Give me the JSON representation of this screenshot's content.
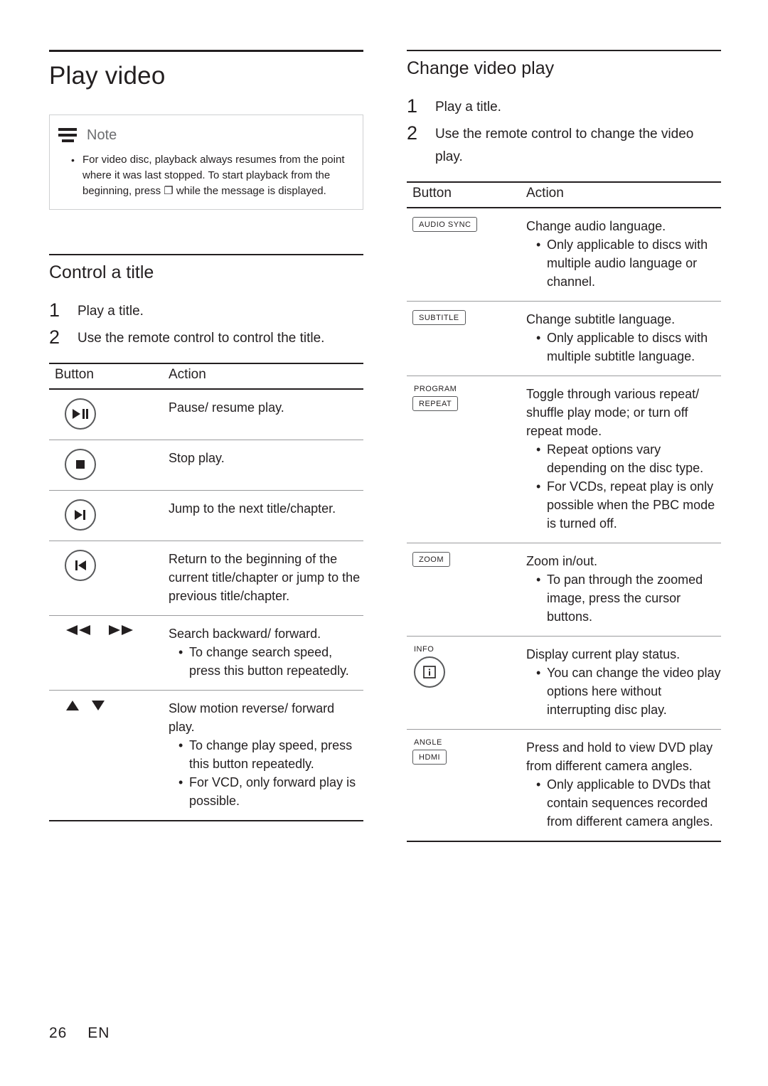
{
  "page": {
    "number": "26",
    "language_code": "EN"
  },
  "left_column": {
    "title": "Play video",
    "note": {
      "label": "Note",
      "items": [
        "For video disc, playback always resumes from the point where it was last stopped. To start playback from the beginning, press ❐ while the message is displayed."
      ]
    },
    "section": {
      "title": "Control a title",
      "steps": [
        {
          "num": "1",
          "text": "Play a title."
        },
        {
          "num": "2",
          "text": "Use the remote control to control the title."
        }
      ],
      "table": {
        "headers": [
          "Button",
          "Action"
        ],
        "rows": [
          {
            "button": {
              "type": "round",
              "icon": "play-pause-icon"
            },
            "lines": [
              "Pause/ resume play."
            ],
            "subs": []
          },
          {
            "button": {
              "type": "round",
              "icon": "stop-icon"
            },
            "lines": [
              "Stop play."
            ],
            "subs": []
          },
          {
            "button": {
              "type": "round",
              "icon": "next-track-icon"
            },
            "lines": [
              "Jump to the next title/chapter."
            ],
            "subs": []
          },
          {
            "button": {
              "type": "round",
              "icon": "previous-track-icon"
            },
            "lines": [
              "Return to the beginning of the current title/chapter or jump to the previous title/chapter."
            ],
            "subs": []
          },
          {
            "button": {
              "type": "arrows",
              "icon": "rewind-forward-icons"
            },
            "lines": [
              "Search backward/ forward."
            ],
            "subs": [
              "To change search speed, press this button repeatedly."
            ]
          },
          {
            "button": {
              "type": "triangles",
              "icon": "up-down-triangle-icons"
            },
            "lines": [
              "Slow motion reverse/ forward play."
            ],
            "subs": [
              "To change play speed, press this button repeatedly.",
              "For VCD, only forward play is possible."
            ]
          }
        ]
      }
    }
  },
  "right_column": {
    "section": {
      "title": "Change video play",
      "steps": [
        {
          "num": "1",
          "text": "Play a title."
        },
        {
          "num": "2",
          "text": "Use the remote control to change the video play."
        }
      ],
      "table": {
        "headers": [
          "Button",
          "Action"
        ],
        "rows": [
          {
            "button": {
              "type": "label",
              "text": "AUDIO SYNC"
            },
            "lines": [
              "Change audio language."
            ],
            "subs": [
              "Only applicable to discs with multiple audio language or channel."
            ]
          },
          {
            "button": {
              "type": "label",
              "text": "SUBTITLE"
            },
            "lines": [
              "Change subtitle language."
            ],
            "subs": [
              "Only applicable to discs with multiple subtitle language."
            ]
          },
          {
            "button": {
              "type": "plain-label",
              "plain": "PROGRAM",
              "text": "REPEAT"
            },
            "lines": [
              "Toggle through various repeat/ shuffle play mode; or turn off repeat mode."
            ],
            "subs": [
              "Repeat options vary depending on the disc type.",
              "For VCDs, repeat play is only possible when the PBC mode is turned off."
            ]
          },
          {
            "button": {
              "type": "label",
              "text": "ZOOM"
            },
            "lines": [
              "Zoom in/out."
            ],
            "subs": [
              "To pan through the zoomed image, press the cursor buttons."
            ]
          },
          {
            "button": {
              "type": "plain-round",
              "plain": "INFO",
              "icon": "info-icon"
            },
            "lines": [
              "Display current play status."
            ],
            "subs": [
              "You can change the video play options here without interrupting disc play."
            ]
          },
          {
            "button": {
              "type": "plain-label",
              "plain": "ANGLE",
              "text": "HDMI"
            },
            "lines": [
              "Press and hold to view DVD play from different camera angles."
            ],
            "subs": [
              "Only applicable to DVDs that contain sequences recorded from different camera angles."
            ]
          }
        ]
      }
    }
  }
}
